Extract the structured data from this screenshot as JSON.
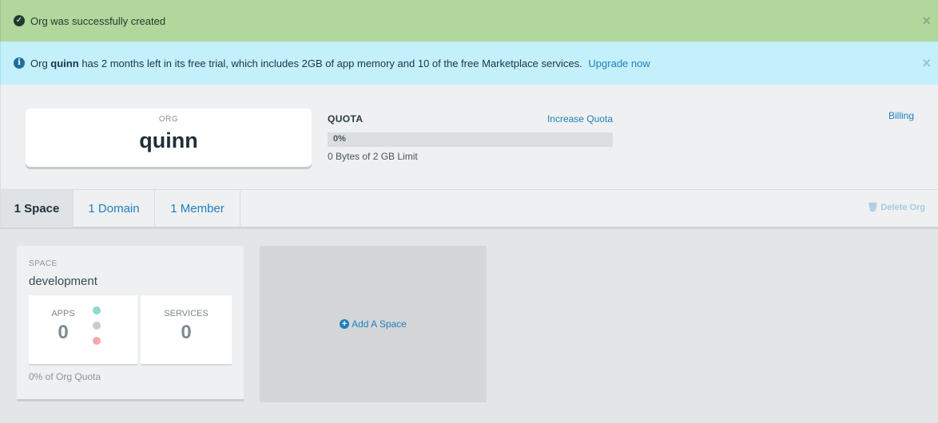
{
  "alerts": {
    "success": {
      "icon": "check-circle-icon",
      "message": "Org was successfully created",
      "close": "×"
    },
    "info": {
      "icon": "info-circle-icon",
      "prefix": "Org",
      "org_name": "quinn",
      "message": "has 2 months left in its free trial, which includes 2GB of app memory and 10 of the free Marketplace services.",
      "link": "Upgrade now",
      "close": "×"
    }
  },
  "org": {
    "label": "ORG",
    "name": "quinn"
  },
  "quota": {
    "title": "QUOTA",
    "increase_link": "Increase Quota",
    "percent_label": "0%",
    "percent_used": 0,
    "usage_text": "0 Bytes of 2 GB Limit"
  },
  "billing_link": "Billing",
  "tabs": [
    {
      "label": "1 Space",
      "active": true
    },
    {
      "label": "1 Domain",
      "active": false
    },
    {
      "label": "1 Member",
      "active": false
    }
  ],
  "delete_org": {
    "icon": "trash-icon",
    "label": "Delete Org"
  },
  "space": {
    "label": "SPACE",
    "name": "development",
    "apps": {
      "label": "APPS",
      "value": "0"
    },
    "services": {
      "label": "SERVICES",
      "value": "0"
    },
    "status_colors": {
      "running": "#8fd8cd",
      "stopped": "#c9cccd",
      "crashed": "#f4a8aa"
    },
    "quota_text": "0% of Org Quota"
  },
  "add_space": {
    "icon": "plus-circle-icon",
    "label": "Add A Space"
  }
}
